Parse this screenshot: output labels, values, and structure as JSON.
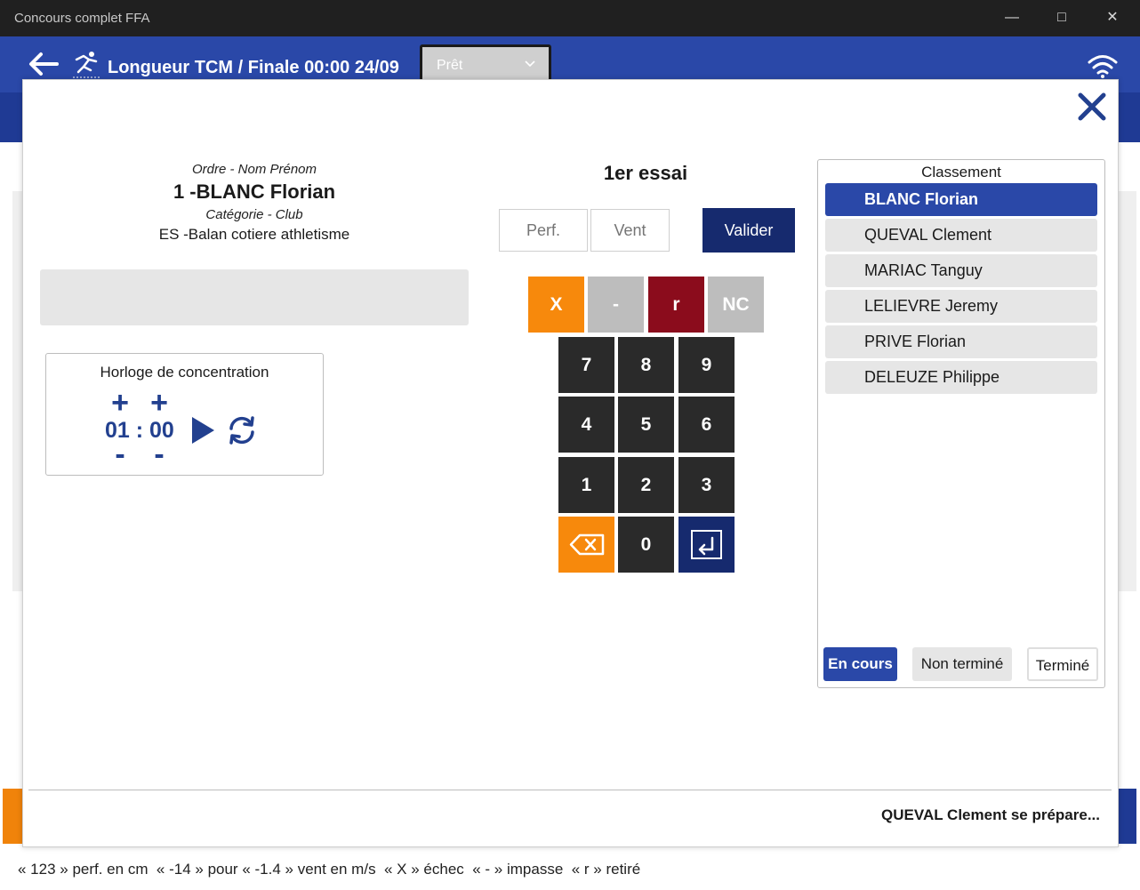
{
  "window": {
    "title": "Concours complet FFA"
  },
  "header": {
    "event_title": "Longueur TCM / Finale 00:00 24/09",
    "status_value": "Prêt"
  },
  "modal": {
    "athlete": {
      "order_label": "Ordre - Nom Prénom",
      "name": "1 -BLANC Florian",
      "category_label": "Catégorie - Club",
      "club": "ES -Balan cotiere athletisme"
    },
    "clock": {
      "title": "Horloge de concentration",
      "plus": "+",
      "minus": "-",
      "time": "01 : 00"
    },
    "attempt_title": "1er essai",
    "perf_placeholder": "Perf.",
    "wind_placeholder": "Vent",
    "validate_label": "Valider",
    "keypad": {
      "special": [
        "X",
        "-",
        "r",
        "NC"
      ],
      "digits": [
        "7",
        "8",
        "9",
        "4",
        "5",
        "6",
        "1",
        "2",
        "3"
      ],
      "zero": "0"
    },
    "ranking": {
      "title": "Classement",
      "items": [
        "BLANC Florian",
        "QUEVAL Clement",
        "MARIAC Tanguy",
        "LELIEVRE Jeremy",
        "PRIVE Florian",
        "DELEUZE Philippe"
      ],
      "tabs": [
        "En cours",
        "Non terminé",
        "Terminé"
      ]
    },
    "status_message": "QUEVAL Clement se prépare..."
  },
  "help_text": "« 123 » perf. en cm  « -14 » pour « -1.4 » vent en m/s  « X » échec  « - » impasse  « r » retiré",
  "colors": {
    "primary": "#2a48a8",
    "navy": "#162a6e",
    "orange": "#f7890c",
    "red": "#8b0c1c",
    "gray_key": "#bdbdbd",
    "dark_key": "#2a2a2a"
  },
  "icons": {
    "back": "arrow-left-icon",
    "event": "long-jump-icon",
    "wifi": "wifi-icon",
    "close": "close-icon",
    "play": "play-icon",
    "reset": "refresh-icon",
    "backspace": "backspace-icon",
    "enter": "enter-icon"
  }
}
